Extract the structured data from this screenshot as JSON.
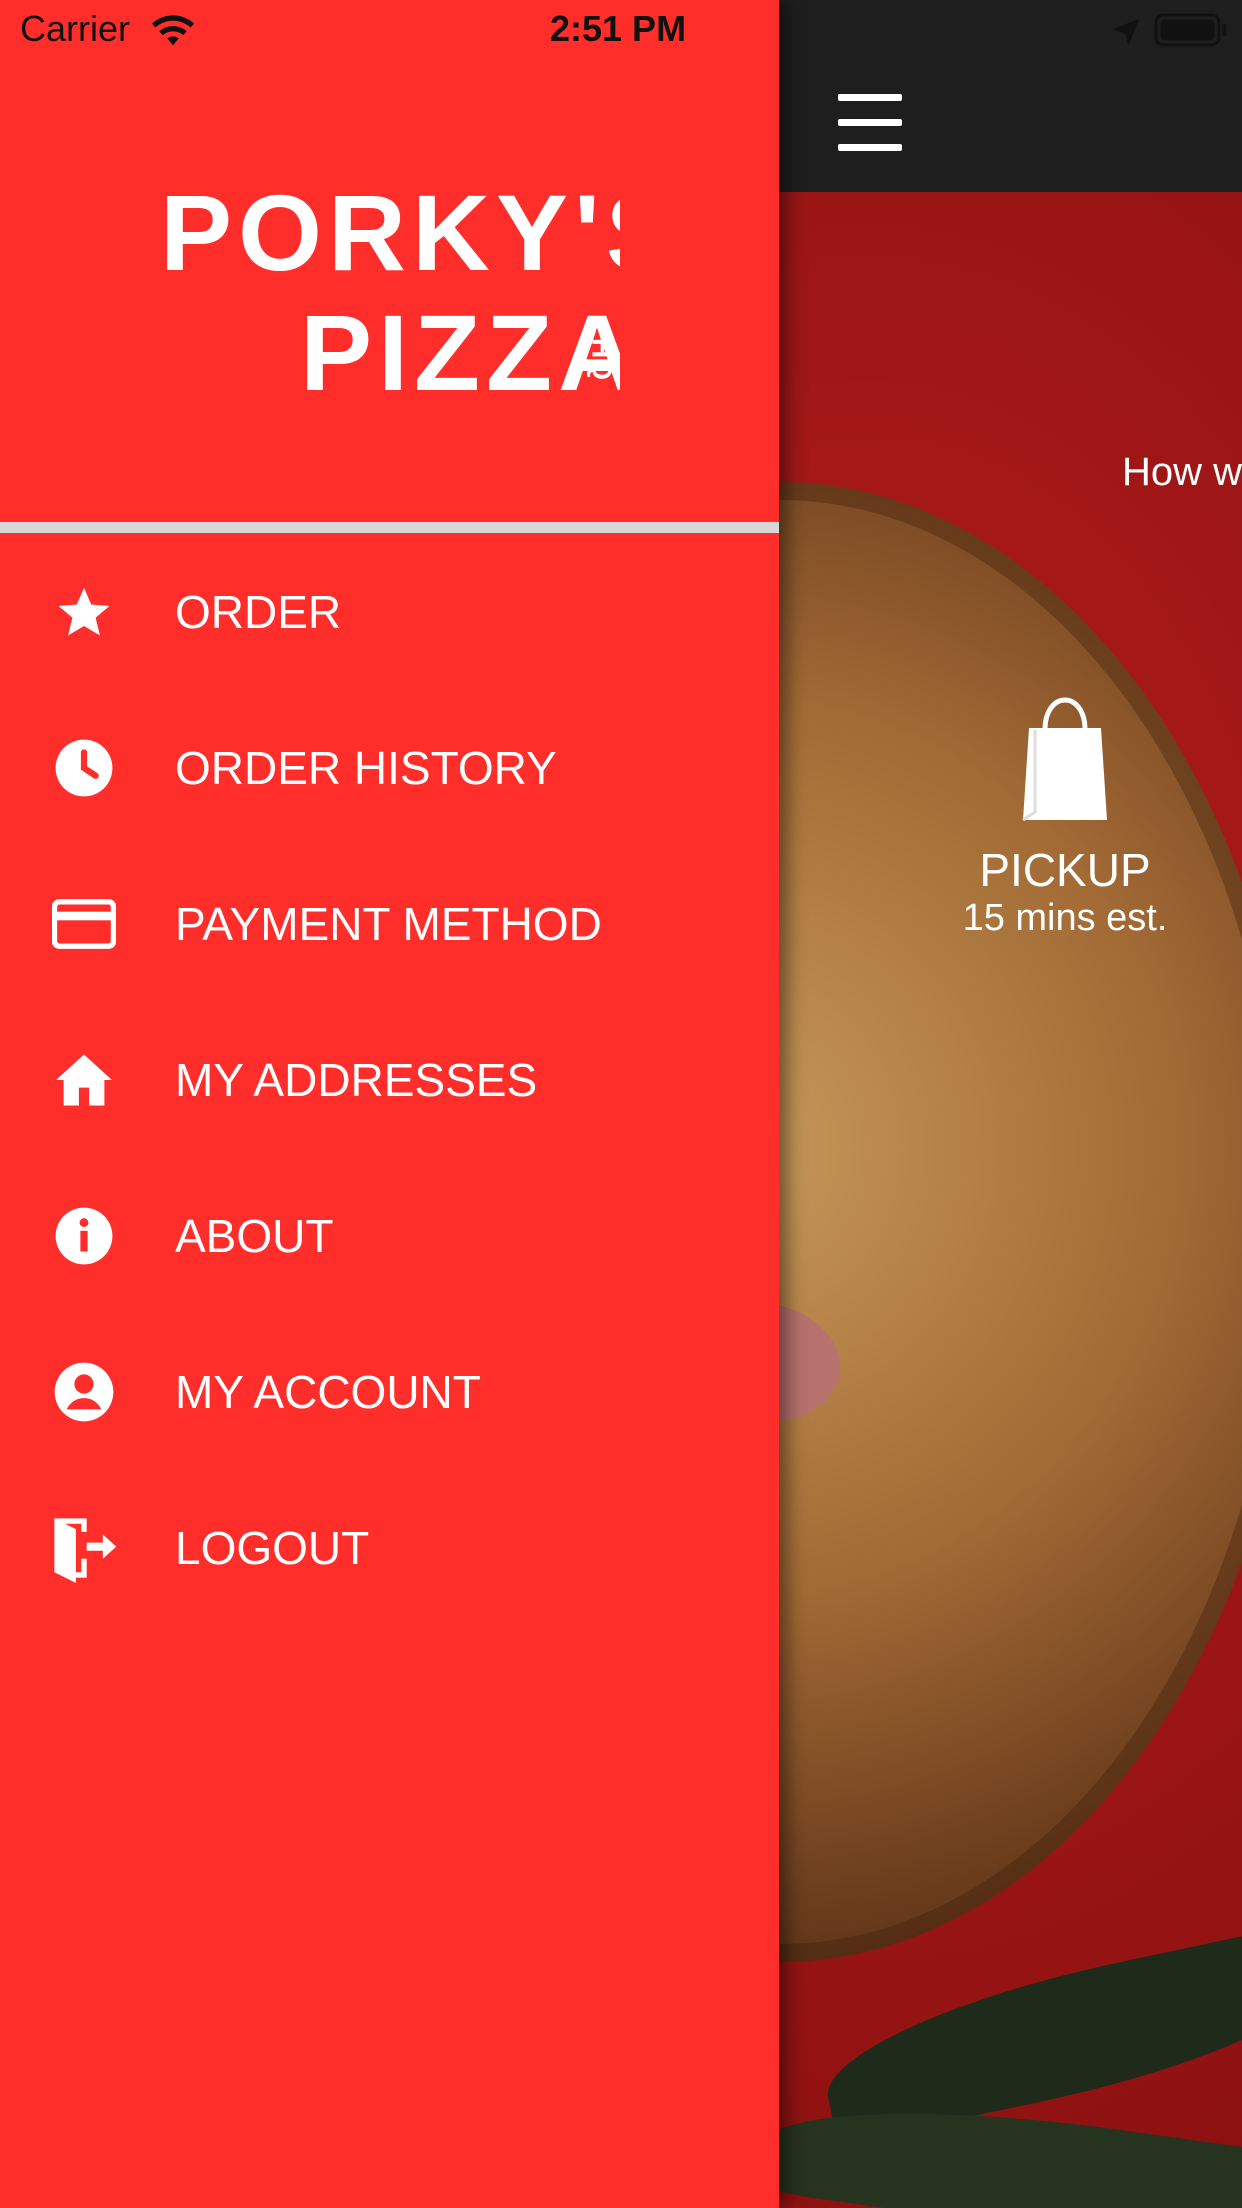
{
  "status_bar": {
    "carrier": "Carrier",
    "time": "2:51 PM"
  },
  "background": {
    "question": "How w",
    "pickup": {
      "title": "PICKUP",
      "subtitle": "15 mins est."
    }
  },
  "drawer": {
    "logo_line1": "PORKY'S",
    "logo_line2": "PIZZA",
    "logo_suffix": "HQ",
    "items": [
      {
        "label": "ORDER",
        "icon": "star-icon"
      },
      {
        "label": "ORDER HISTORY",
        "icon": "clock-icon"
      },
      {
        "label": "PAYMENT METHOD",
        "icon": "credit-card-icon"
      },
      {
        "label": "MY ADDRESSES",
        "icon": "home-icon"
      },
      {
        "label": "ABOUT",
        "icon": "info-icon"
      },
      {
        "label": "MY ACCOUNT",
        "icon": "account-icon"
      },
      {
        "label": "LOGOUT",
        "icon": "logout-icon"
      }
    ]
  },
  "colors": {
    "drawer_bg": "#ff2e2b",
    "top_bar": "#1e1e1e",
    "divider": "#d9d6d6"
  }
}
